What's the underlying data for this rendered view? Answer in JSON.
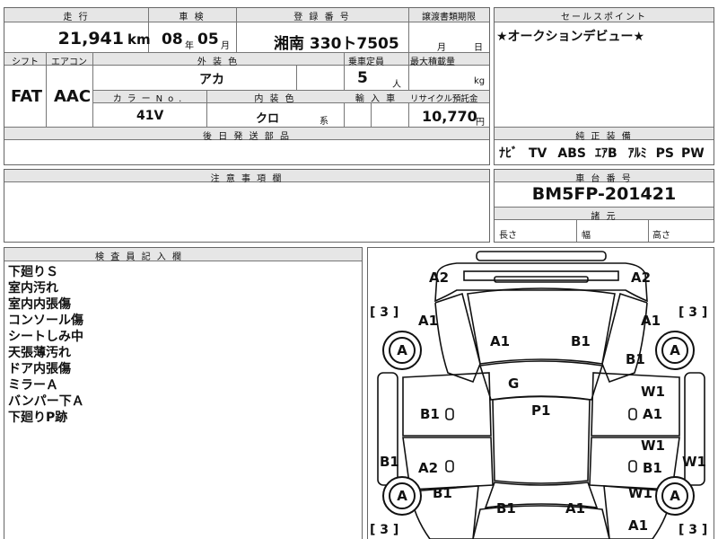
{
  "header": {
    "mileage_label": "走 行",
    "inspection_label": "車 検",
    "registration_label": "登 録 番 号",
    "transfer_docs_label": "譲渡書類期限",
    "sales_point_label": "セールスポイント"
  },
  "values": {
    "mileage": "21,941",
    "mileage_unit": "km",
    "inspection_year": "08",
    "year_unit": "年",
    "inspection_month": "05",
    "month_unit": "月",
    "registration": "湘南 330ト7505",
    "transfer_month_unit": "月",
    "transfer_day_unit": "日",
    "sales_point": "★オークションデビュー★"
  },
  "row2": {
    "shift_label": "シフト",
    "ac_label": "エアコン",
    "exterior_label": "外 装 色",
    "capacity_label": "乗車定員",
    "max_load_label": "最大積載量",
    "shift": "FAT",
    "ac": "AAC",
    "exterior_color": "アカ",
    "capacity": "5",
    "capacity_unit": "人",
    "load_unit": "kg",
    "color_no_label": "カラーNo.",
    "interior_label": "内 装 色",
    "import_label": "輸 入 車",
    "recycle_label": "リサイクル預託金",
    "color_no": "41V",
    "interior_color": "クロ",
    "interior_suffix": "系",
    "recycle_fee": "10,770",
    "yen_unit": "円",
    "later_parts_label": "後 日 発 送 部 品"
  },
  "equipment": {
    "label": "純 正 装 備",
    "items": [
      "ﾅﾋﾞ",
      "TV",
      "ABS",
      "ｴｱB",
      "ｱﾙﾐ",
      "PS",
      "PW"
    ]
  },
  "notes": {
    "label": "注 意 事 項 欄"
  },
  "chassis": {
    "label": "車 台 番 号",
    "number": "BM5FP-201421",
    "dims_label": "諸 元",
    "length_label": "長さ",
    "width_label": "幅",
    "height_label": "高さ"
  },
  "inspector": {
    "label": "検 査 員 記 入 欄",
    "remarks": [
      "下廻りＳ",
      "室内汚れ",
      "室内内張傷",
      "コンソール傷",
      "シートしみ中",
      "天張薄汚れ",
      "ドア内張傷",
      "ミラーＡ",
      "バンパー下Ａ",
      "下廻りP跡"
    ]
  },
  "diagram": {
    "tire_grade": "[ 3 ]",
    "tire_mark": "A",
    "marks": {
      "front_left_corner": "A2",
      "front_right_corner": "A2",
      "left_fender": "A1",
      "right_fender": "A1",
      "hood_left": "A1",
      "hood_right": "B1",
      "right_fender_low": "B1",
      "windshield": "G",
      "left_front_door": "B1",
      "roof": "P1",
      "right_front_door_top": "W1",
      "right_front_door": "A1",
      "left_rocker": "B1",
      "left_rear_door": "A2",
      "right_rear_door_top": "W1",
      "right_rear_door": "B1",
      "right_rocker": "W1",
      "left_rear_fender": "B1",
      "right_rear_fender": "W1",
      "trunk_left": "B1",
      "trunk_right": "A1",
      "rear_right_corner": "A1"
    }
  }
}
